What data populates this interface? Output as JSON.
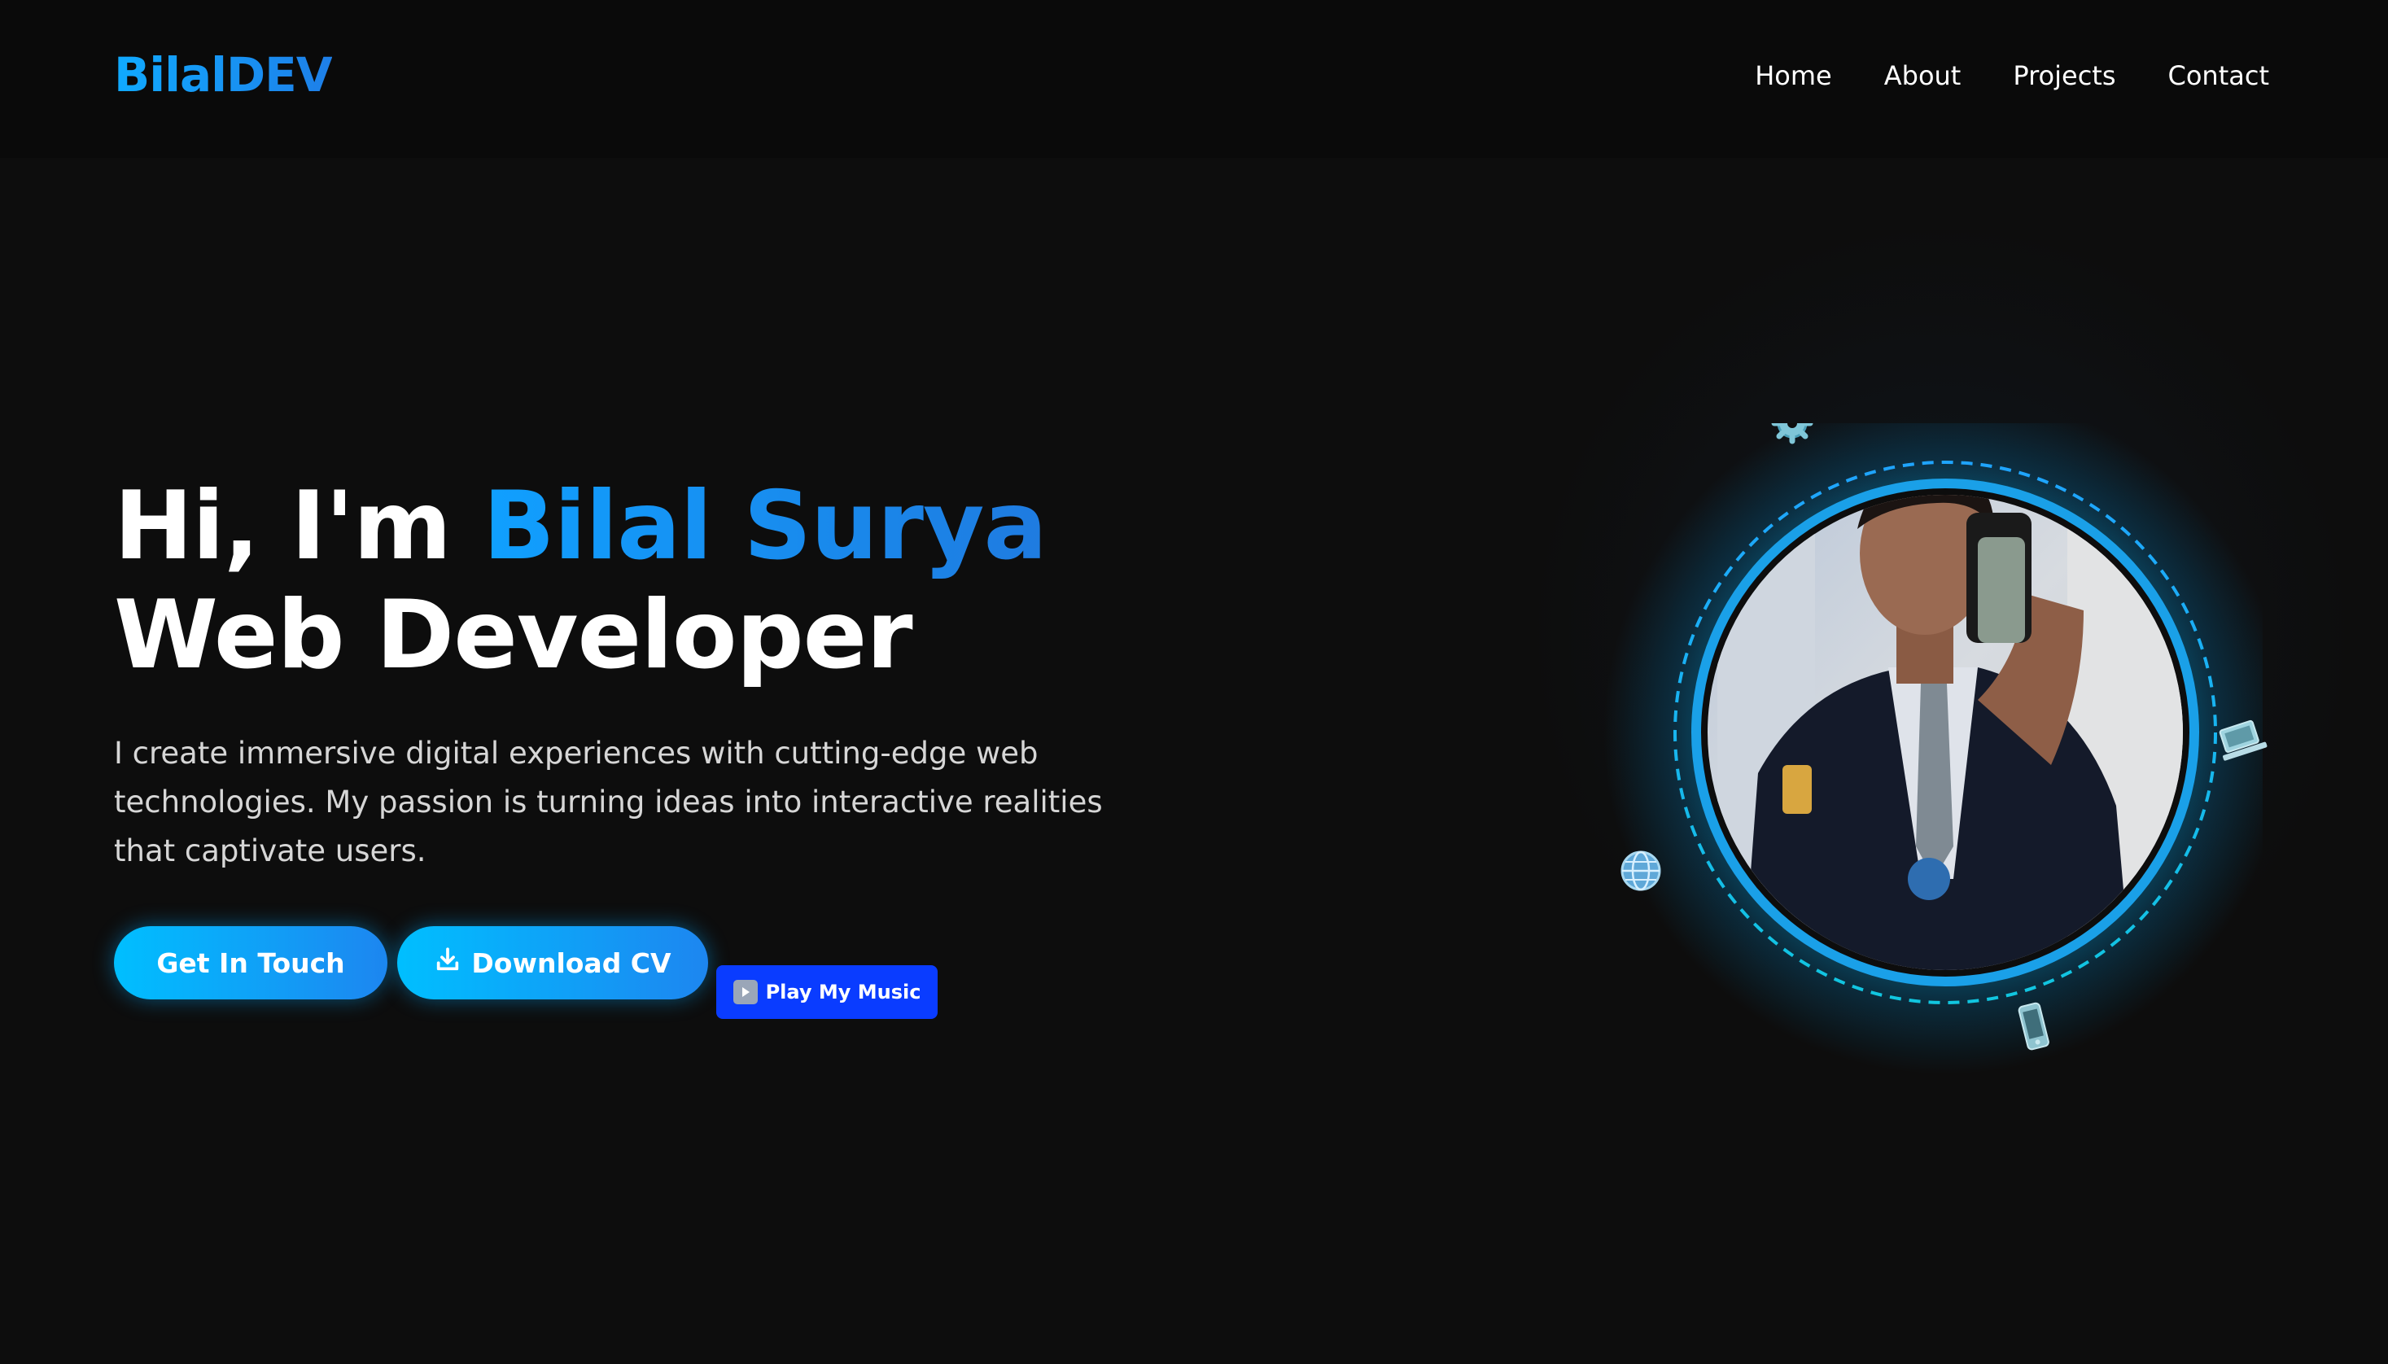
{
  "header": {
    "logo": "BilalDEV",
    "nav": [
      {
        "label": "Home"
      },
      {
        "label": "About"
      },
      {
        "label": "Projects"
      },
      {
        "label": "Contact"
      }
    ]
  },
  "hero": {
    "greeting": "Hi, I'm ",
    "name": "Bilal Surya",
    "role": "Web Developer",
    "description": "I create immersive digital experiences with cutting-edge web technologies. My passion is turning ideas into interactive realities that captivate users."
  },
  "buttons": {
    "get_in_touch": "Get In Touch",
    "download_cv": "Download CV",
    "play_music": "Play My Music"
  },
  "icons": {
    "download": "download-icon",
    "play": "play-icon",
    "gear": "gear-icon",
    "globe": "globe-icon",
    "laptop": "laptop-icon",
    "phone": "phone-icon"
  },
  "colors": {
    "background": "#0d0d0d",
    "accent": "#1e90ff",
    "accent_cyan": "#00bfff",
    "music_button": "#0a3cff"
  }
}
